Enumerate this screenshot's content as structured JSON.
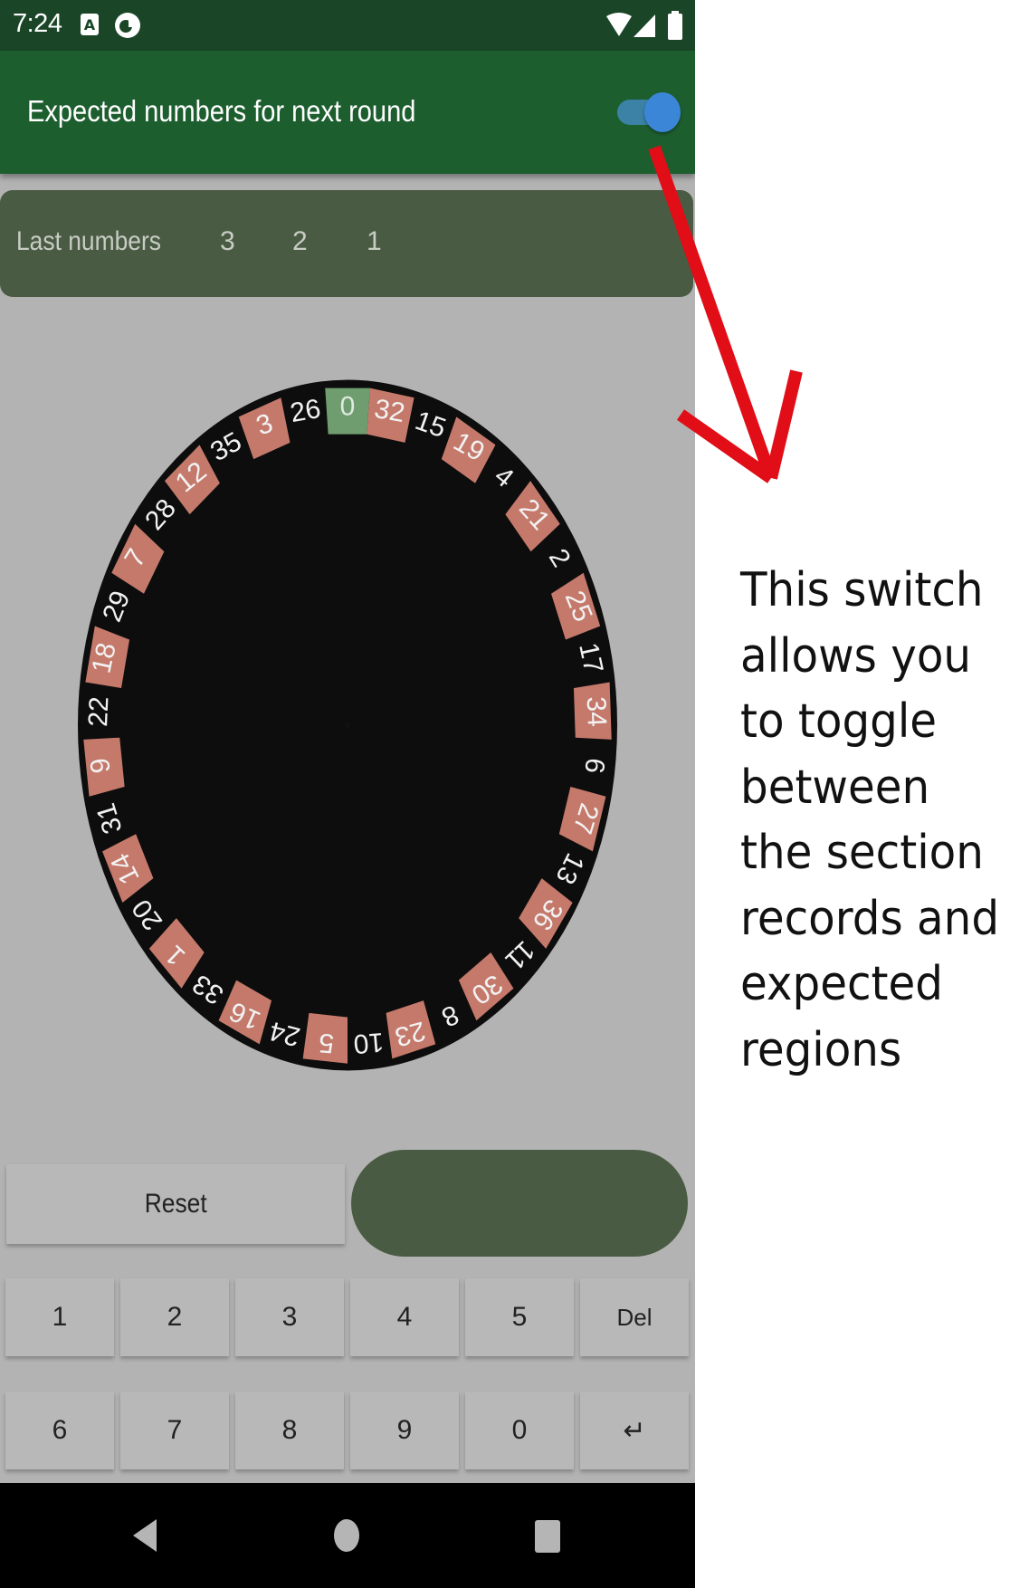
{
  "status_bar": {
    "time": "7:24",
    "left_icons": [
      "a-notification-icon",
      "circle-app-icon"
    ],
    "right_icons": [
      "wifi-icon",
      "signal-icon",
      "battery-icon"
    ]
  },
  "app_bar": {
    "title": "Expected numbers for next round",
    "toggle_on": true
  },
  "last_numbers": {
    "label": "Last numbers",
    "values": [
      "3",
      "2",
      "1"
    ]
  },
  "wheel": {
    "sequence": [
      "0",
      "32",
      "15",
      "19",
      "4",
      "21",
      "2",
      "25",
      "17",
      "34",
      "6",
      "27",
      "13",
      "36",
      "11",
      "30",
      "8",
      "23",
      "10",
      "5",
      "24",
      "16",
      "33",
      "1",
      "20",
      "14",
      "31",
      "9",
      "22",
      "18",
      "29",
      "7",
      "28",
      "12",
      "35",
      "3",
      "26"
    ],
    "red_numbers": [
      "32",
      "19",
      "21",
      "25",
      "34",
      "27",
      "36",
      "30",
      "23",
      "5",
      "16",
      "1",
      "14",
      "9",
      "18",
      "7",
      "12",
      "3"
    ],
    "highlighted_region": [
      "29",
      "7",
      "28",
      "12",
      "35",
      "3",
      "26",
      "0",
      "32"
    ],
    "colors": {
      "zero": "#6f9d6f",
      "red": "#c4796b",
      "black": "#0d0d0d",
      "highlight": "#b29e66",
      "face": "#cccccc"
    }
  },
  "buttons": {
    "reset": "Reset",
    "keypad_row1": [
      "1",
      "2",
      "3",
      "4",
      "5",
      "Del"
    ],
    "keypad_row2": [
      "6",
      "7",
      "8",
      "9",
      "0",
      "↵"
    ]
  },
  "nav_bar": {
    "icons": [
      "back-icon",
      "home-icon",
      "recents-icon"
    ]
  },
  "annotation": {
    "lines": [
      "This switch",
      "allows you",
      "to toggle",
      "between",
      "the section",
      "records and",
      "expected",
      "regions"
    ],
    "arrow_color": "#e10d17"
  }
}
